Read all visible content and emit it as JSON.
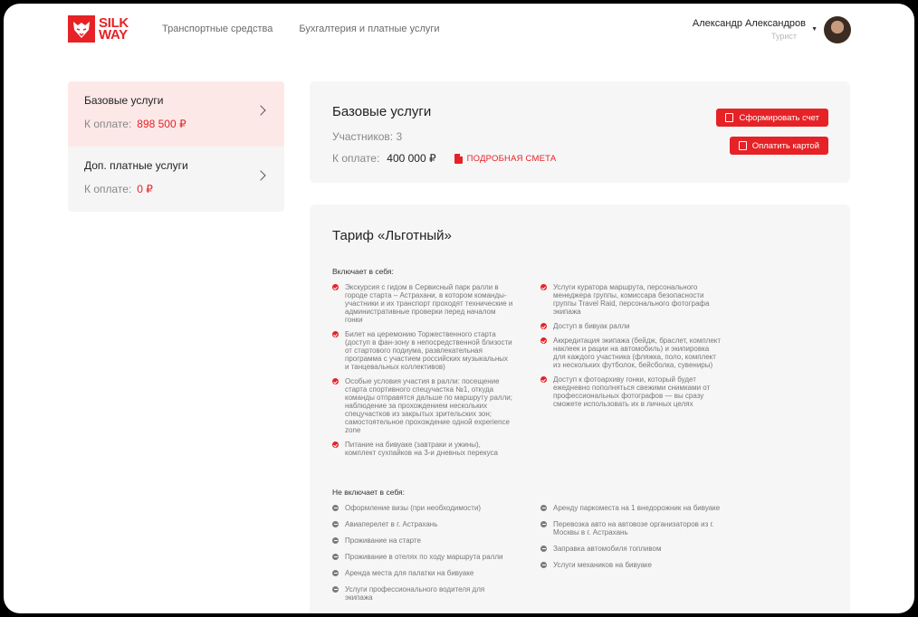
{
  "header": {
    "logo": {
      "line1": "SILK",
      "line2": "WAY"
    },
    "nav": [
      "Транспортные средства",
      "Бухгалтерия и платные услуги"
    ],
    "user": {
      "name": "Александр Александров",
      "role": "Турист"
    }
  },
  "sidebar": {
    "items": [
      {
        "title": "Базовые услуги",
        "amount_label": "К оплате:",
        "amount": "898 500 ₽"
      },
      {
        "title": "Доп. платные услуги",
        "amount_label": "К оплате:",
        "amount": "0 ₽"
      }
    ]
  },
  "summary": {
    "title": "Базовые услуги",
    "participants": "Участников: 3",
    "amount_label": "К оплате:",
    "amount": "400 000 ₽",
    "estimate_link": "ПОДРОБНАЯ СМЕТА",
    "btn_invoice": "Сформировать счет",
    "btn_pay": "Оплатить картой"
  },
  "tariff": {
    "title": "Тариф «Льготный»",
    "includes_label": "Включает в себя:",
    "includes_left": [
      "Экскурсия с гидом в Сервисный парк ралли в городе старта – Астрахани, в котором команды-участники и их транспорт проходят технические и административные проверки перед началом гонки",
      "Билет на церемонию Торжественного старта (доступ в фан-зону в непосредственной близости от стартового подиума, развлекательная программа с участием российских музыкальных и танцевальных коллективов)",
      "Особые условия участия в ралли: посещение старта спортивного спецучастка №1, откуда команды отправятся дальше по маршруту ралли; наблюдение за прохождением нескольких спецучастков из закрытых зрительских зон; самостоятельное прохождение одной experience zone",
      "Питание на бивуаке (завтраки и ужины), комплект сухпайков на 3-и дневных перекуса"
    ],
    "includes_right": [
      "Услуги куратора маршрута, персонального менеджера группы, комиссара безопасности группы Travel Raid, персонального фотографа экипажа",
      "Доступ в бивуак ралли",
      "Аккредитация экипажа (бейдж, браслет, комплект наклеек и рации на автомобиль) и экипировка для каждого участника (фляжка, поло, комплект из нескольких футболок, бейсболка, сувениры)",
      "Доступ к фотоархиву гонки, который будет ежедневно пополняться свежими снимками от профессиональных фотографов — вы сразу сможете использовать их в личных целях"
    ],
    "excludes_label": "Не включает в себя:",
    "excludes_left": [
      "Оформление визы (при необходимости)",
      "Авиаперелет в г. Астрахань",
      "Проживание на старте",
      "Проживание в отелях по ходу маршрута ралли",
      "Аренда места для палатки на бивуаке",
      "Услуги профессионального водителя для экипажа"
    ],
    "excludes_right": [
      "Аренду паркоместа на 1 внедорожник на бивуаке",
      "Перевозка авто на автовозе организаторов из г. Москвы в г. Астрахань",
      "Заправка автомобиля топливом",
      "Услуги механиков на бивуаке"
    ]
  },
  "colors": {
    "accent": "#e62226",
    "active_bg": "#fde8e8",
    "card_bg": "#f6f6f6"
  }
}
